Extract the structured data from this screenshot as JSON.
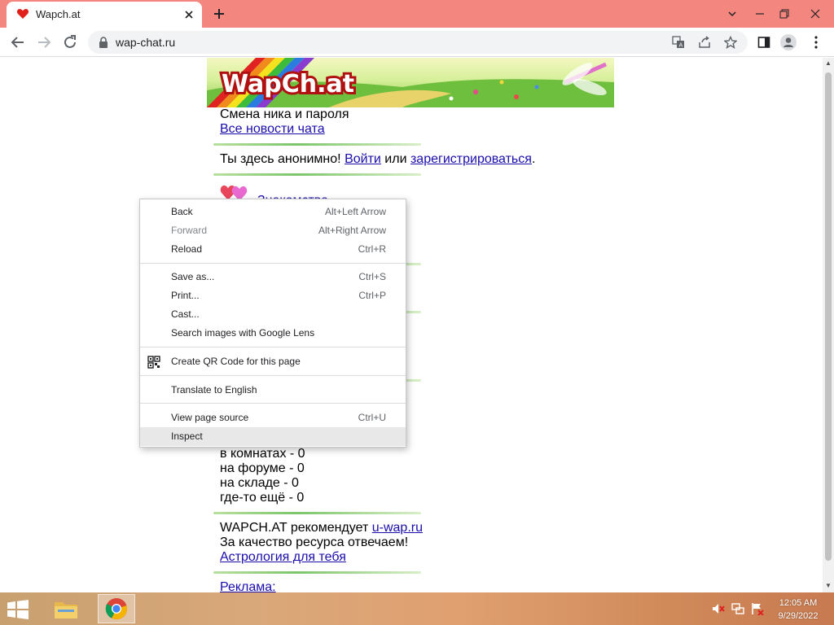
{
  "browser": {
    "tab_title": "Wapch.at",
    "url": "wap-chat.ru",
    "accent_color": "#f3867e"
  },
  "banner": {
    "logo_text": "WapCh.at"
  },
  "page": {
    "top_link_pink": "Смена ника и пароля",
    "news_link": "Все новости чата",
    "anon_prefix": "Ты здесь анонимно!",
    "login_link": "Войти",
    "anon_or": "или",
    "register_link": "зарегистрироваться",
    "anon_suffix": ".",
    "dating_link": "Знакомства",
    "stats": [
      "в комнатах - 0",
      "на форуме - 0",
      "на складе - 0",
      "где-то ещё - 0"
    ],
    "recommend_prefix": "WAPCH.AT рекомендует",
    "recommend_link": "u-wap.ru",
    "quality_text": "За качество ресурса отвечаем!",
    "astro_link": "Астрология для тебя",
    "ads_link": "Реклама:"
  },
  "context_menu": {
    "items": [
      {
        "label": "Back",
        "shortcut": "Alt+Left Arrow"
      },
      {
        "label": "Forward",
        "shortcut": "Alt+Right Arrow"
      },
      {
        "label": "Reload",
        "shortcut": "Ctrl+R"
      },
      {
        "label": "Save as...",
        "shortcut": "Ctrl+S"
      },
      {
        "label": "Print...",
        "shortcut": "Ctrl+P"
      },
      {
        "label": "Cast...",
        "shortcut": ""
      },
      {
        "label": "Search images with Google Lens",
        "shortcut": ""
      },
      {
        "label": "Create QR Code for this page",
        "shortcut": ""
      },
      {
        "label": "Translate to English",
        "shortcut": ""
      },
      {
        "label": "View page source",
        "shortcut": "Ctrl+U"
      },
      {
        "label": "Inspect",
        "shortcut": ""
      }
    ]
  },
  "taskbar": {
    "time": "12:05 AM",
    "date": "9/29/2022"
  }
}
